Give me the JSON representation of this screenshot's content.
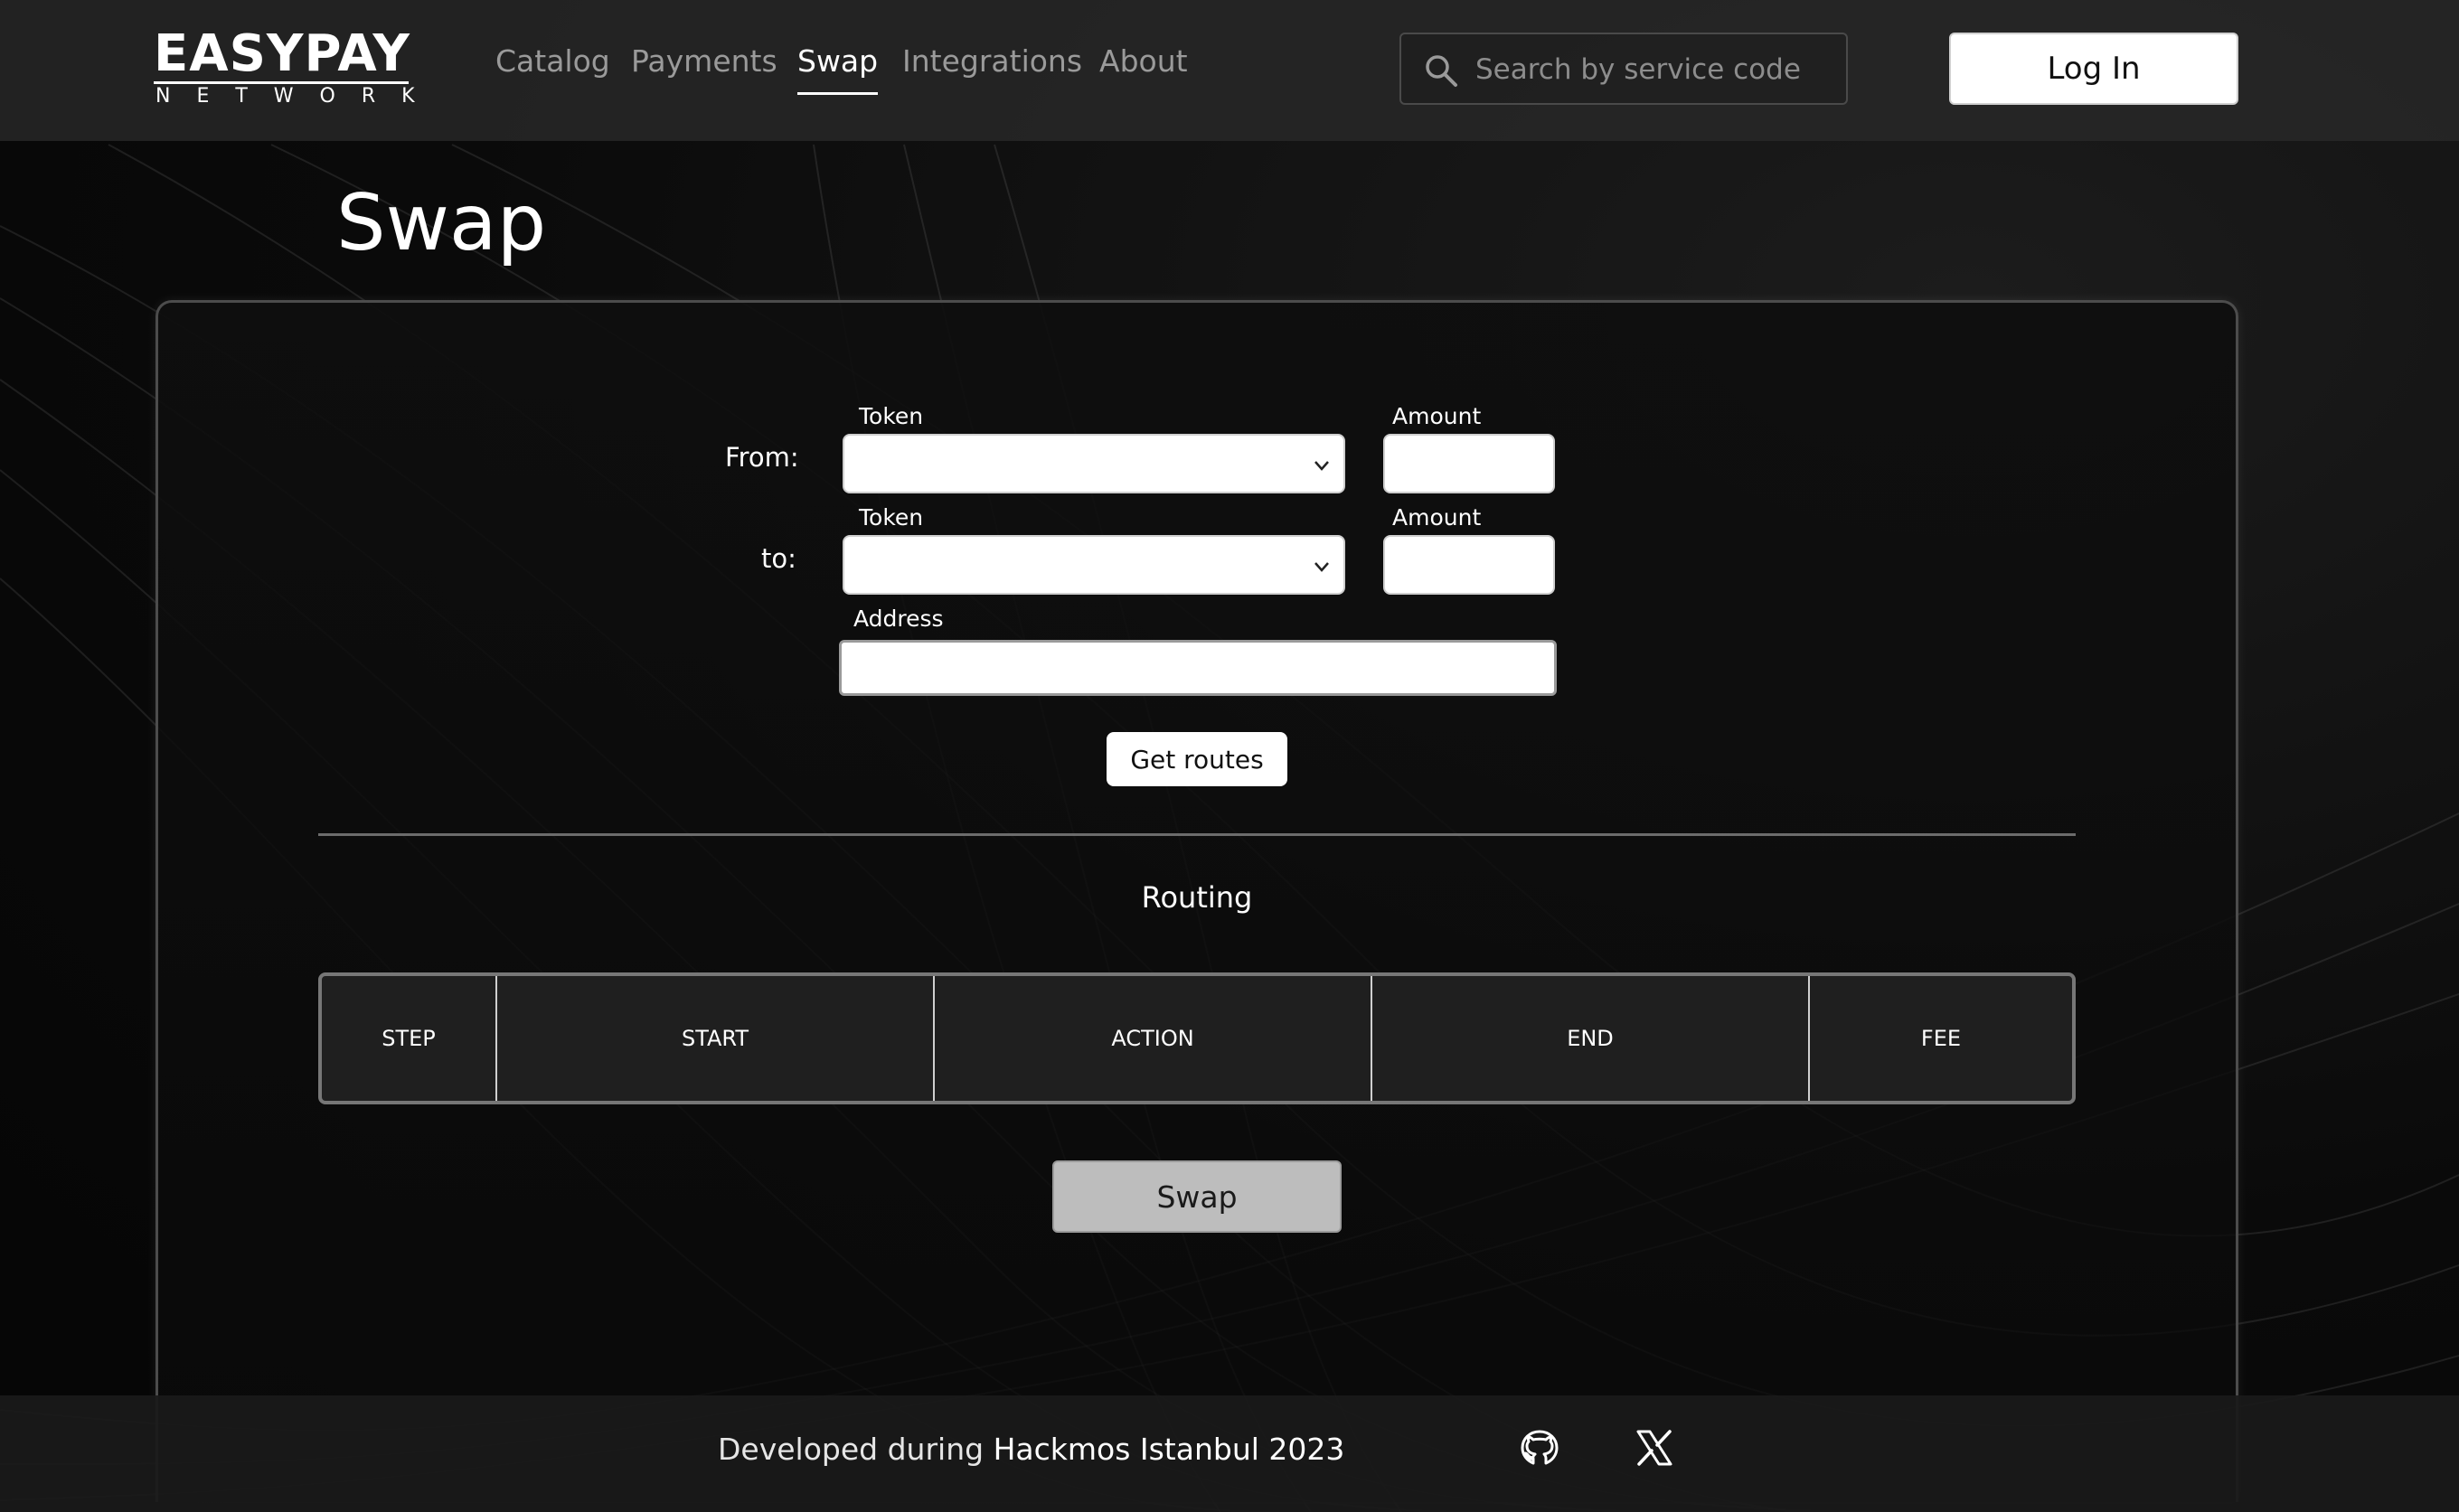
{
  "brand": {
    "name": "EASYPAY",
    "sub": "NETWORK"
  },
  "nav": {
    "items": [
      {
        "label": "Catalog",
        "active": false
      },
      {
        "label": "Payments",
        "active": false
      },
      {
        "label": "Swap",
        "active": true
      },
      {
        "label": "Integrations",
        "active": false
      },
      {
        "label": "About",
        "active": false
      }
    ]
  },
  "search": {
    "placeholder": "Search by service code",
    "value": "",
    "icon": "search-icon"
  },
  "login": {
    "label": "Log In"
  },
  "page": {
    "title": "Swap"
  },
  "form": {
    "from_label": "From:",
    "to_label": "to:",
    "token_label": "Token",
    "amount_label": "Amount",
    "address_label": "Address",
    "from_token": "",
    "from_amount": "",
    "to_token": "",
    "to_amount": "",
    "address": "",
    "get_routes_label": "Get routes"
  },
  "routing": {
    "title": "Routing",
    "columns": [
      "STEP",
      "START",
      "ACTION",
      "END",
      "FEE"
    ],
    "rows": []
  },
  "swap_button": {
    "label": "Swap"
  },
  "footer": {
    "text_prefix": "Developed during",
    "event": "Hackmos Istanbul 2023",
    "icons": [
      "github-icon",
      "x-icon"
    ]
  },
  "colors": {
    "background": "#0b0b0b",
    "header": "#282828",
    "accent_white": "#ffffff",
    "nav_inactive": "#9a9a9a",
    "swap_button": "#bdbdbd"
  }
}
